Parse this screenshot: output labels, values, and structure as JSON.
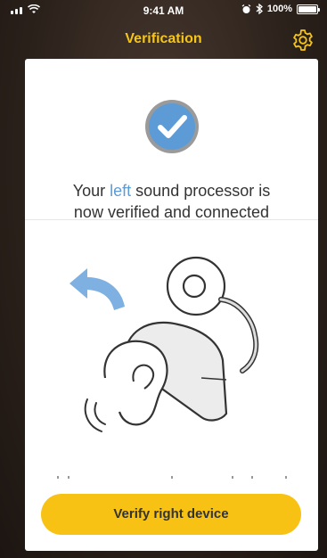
{
  "status_bar": {
    "time": "9:41 AM",
    "battery": "100%",
    "battery_level": 1.0
  },
  "nav": {
    "title": "Verification",
    "settings_icon": "gear-icon"
  },
  "colors": {
    "accent": "#f5c518",
    "button": "#f7c214",
    "highlight": "#5c9bd6",
    "check_ring": "#9a9a9a"
  },
  "content": {
    "message_prefix": "Your ",
    "message_side": "left",
    "message_line1_suffix": " sound processor is",
    "message_line2": "now verified and connected",
    "illustration_icon": "sound-processor-on-ear-icon"
  },
  "actions": {
    "primary_label": "Verify right device"
  }
}
